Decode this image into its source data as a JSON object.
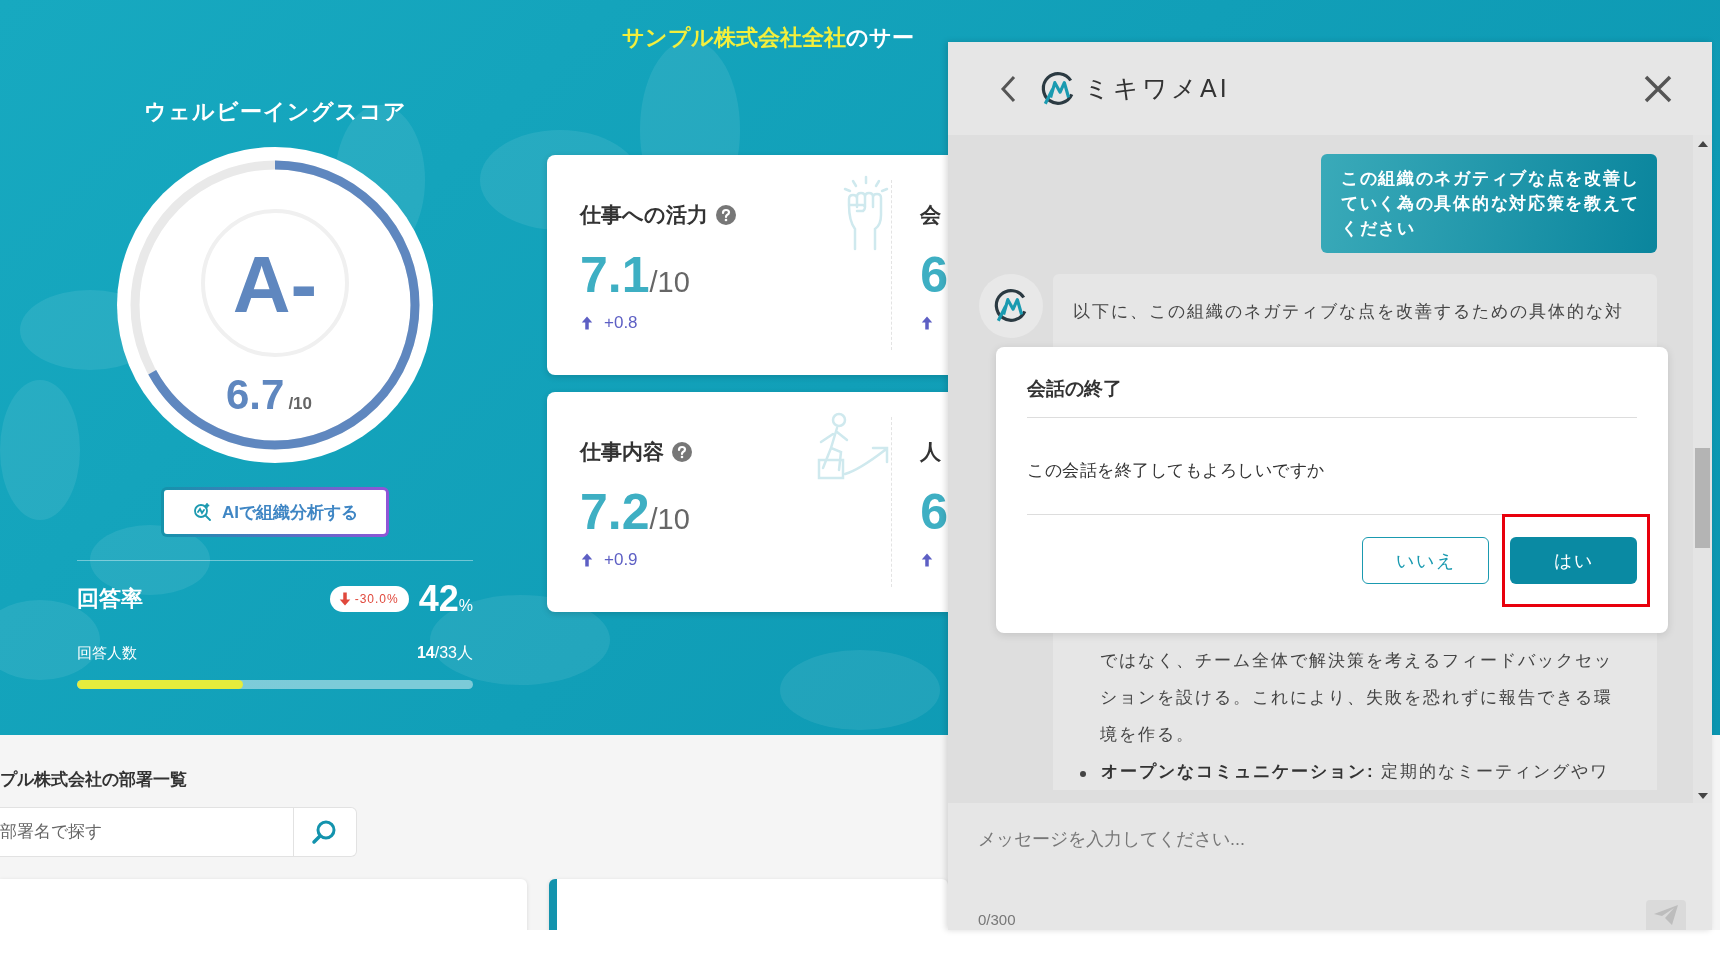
{
  "header": {
    "title_highlight": "サンプル株式会社全社",
    "title_rest": "のサー"
  },
  "wellbeing": {
    "title": "ウェルビーイングスコア",
    "grade": "A-",
    "score": "6.7",
    "score_max": "/10",
    "level": 0.67,
    "ai_button": "AIで組織分析する"
  },
  "response": {
    "label": "回答率",
    "change": "-30.0%",
    "rate": "42",
    "rate_unit": "%",
    "count_label": "回答人数",
    "count": "**14**/33人",
    "level": 0.42
  },
  "score_cards": [
    {
      "title": "仕事への活力",
      "value": "7.1",
      "max": "/10",
      "delta": "+0.8",
      "side_title": "会",
      "side_value": "6"
    },
    {
      "title": "仕事内容",
      "value": "7.2",
      "max": "/10",
      "delta": "+0.9",
      "side_title": "人",
      "side_value": "6"
    }
  ],
  "departments": {
    "title": "プル株式会社の部署一覧",
    "search_placeholder": "部署名で探す"
  },
  "chat": {
    "title": "ミキワメAI",
    "user_message": "この組織のネガティブな点を改善していく為の具体的な対応策を教えてください",
    "ai_message": {
      "first_line": "以下に、この組織のネガティブな点を改善するための具体的な対",
      "continuation": "ではなく、チーム全体で解決策を考えるフィードバックセッションを設ける。これにより、失敗を恐れずに報告できる環境を作る。",
      "bullets": [
        "**オープンなコミュニケーション:** 定期的なミーティングやワ"
      ]
    },
    "input_placeholder": "メッセージを入力してください...",
    "counter": "0/300"
  },
  "dialog": {
    "title": "会話の終了",
    "message": "この会話を終了してもよろしいですか",
    "buttons": [
      {
        "label": "いいえ",
        "kind": "secondary",
        "highlighted": false
      },
      {
        "label": "はい",
        "kind": "primary",
        "highlighted": true
      }
    ]
  }
}
